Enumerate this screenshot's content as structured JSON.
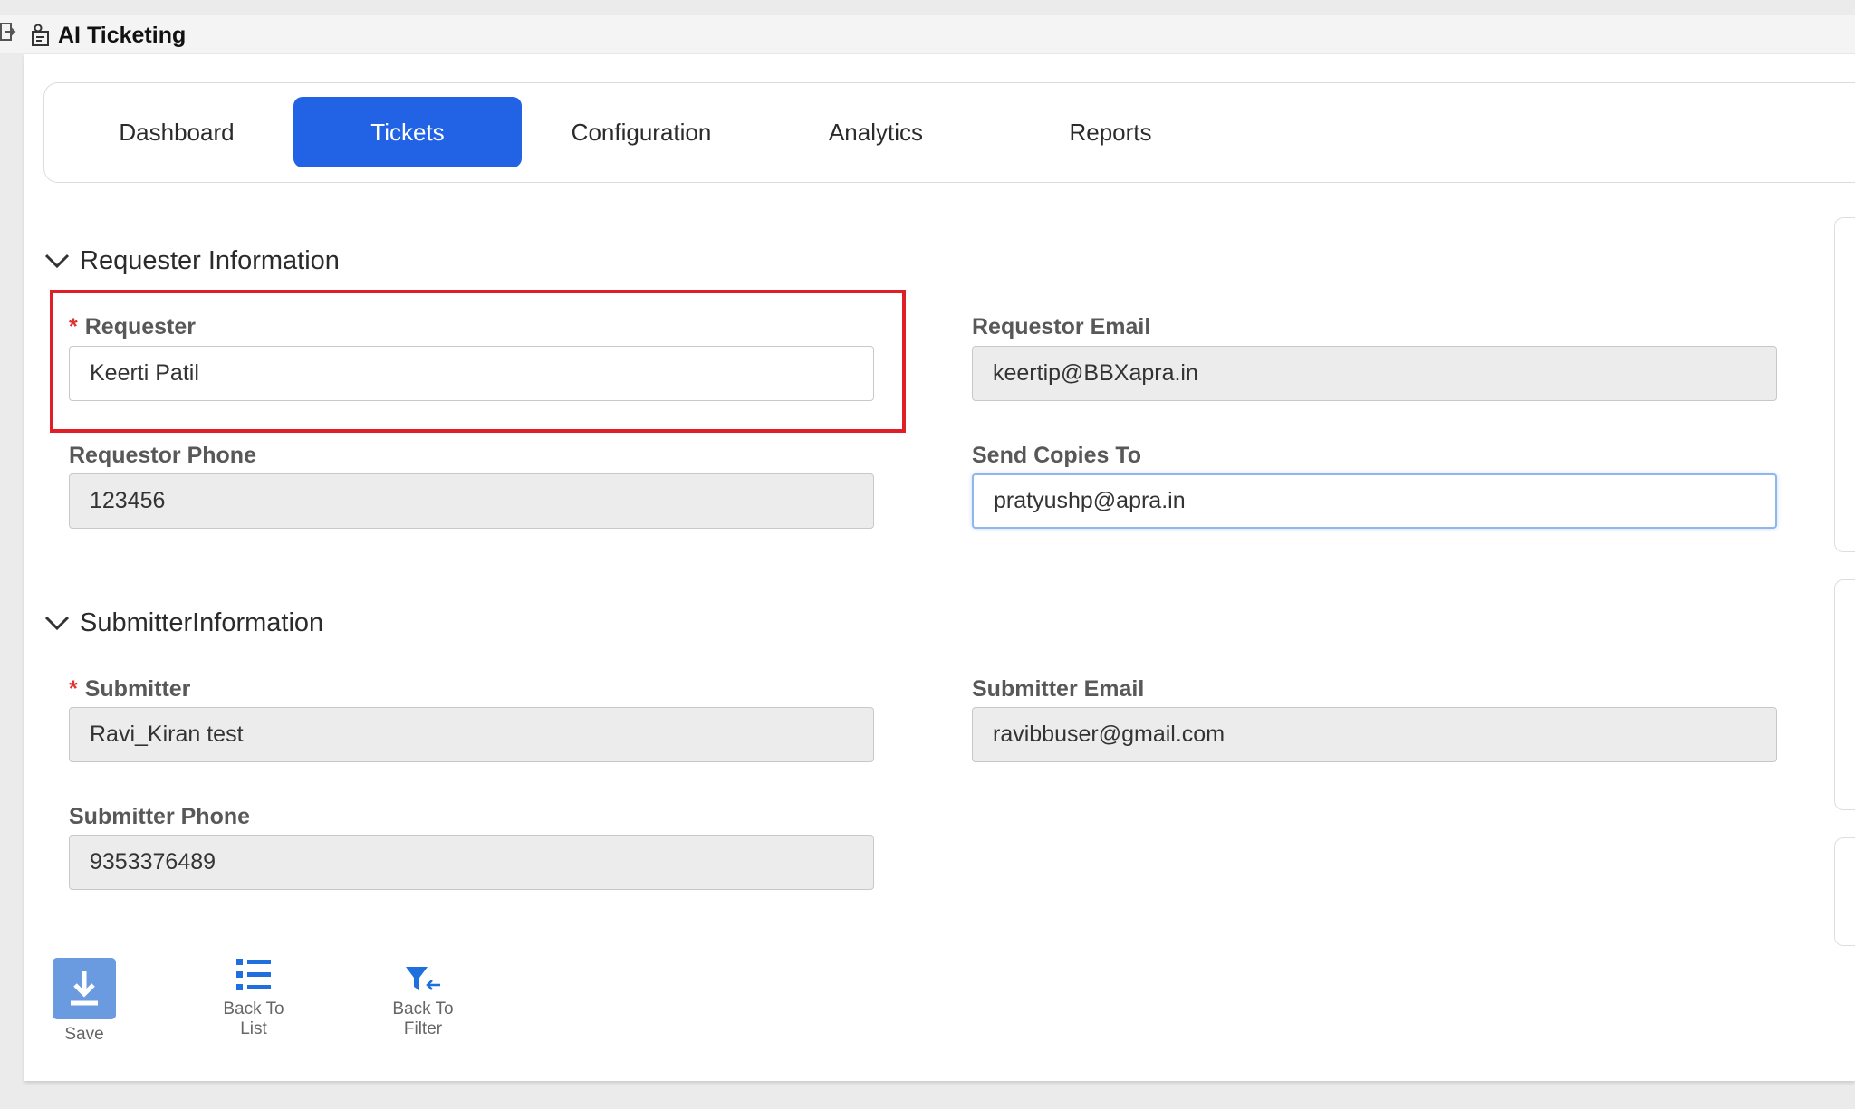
{
  "app": {
    "title": "AI Ticketing"
  },
  "tabs": [
    {
      "label": "Dashboard",
      "active": false
    },
    {
      "label": "Tickets",
      "active": true
    },
    {
      "label": "Configuration",
      "active": false
    },
    {
      "label": "Analytics",
      "active": false
    },
    {
      "label": "Reports",
      "active": false
    }
  ],
  "requester_section": {
    "title": "Requester Information",
    "requester": {
      "label": "Requester",
      "required": "*",
      "value": "Keerti Patil"
    },
    "requestor_email": {
      "label": "Requestor Email",
      "value": "keertip@BBXapra.in"
    },
    "requestor_phone": {
      "label": "Requestor Phone",
      "value": "123456"
    },
    "send_copies": {
      "label": "Send Copies To",
      "value": "pratyushp@apra.in"
    }
  },
  "submitter_section": {
    "title": "SubmitterInformation",
    "submitter": {
      "label": "Submitter",
      "required": "*",
      "value": "Ravi_Kiran test"
    },
    "submitter_email": {
      "label": "Submitter Email",
      "value": "ravibbuser@gmail.com"
    },
    "submitter_phone": {
      "label": "Submitter Phone",
      "value": "9353376489"
    }
  },
  "actions": {
    "save": "Save",
    "back_to_list_1": "Back To",
    "back_to_list_2": "List",
    "back_to_filter_1": "Back To",
    "back_to_filter_2": "Filter"
  },
  "colors": {
    "accent": "#2263e5",
    "highlight": "#e01e26",
    "save_bg": "#6a9be0"
  }
}
